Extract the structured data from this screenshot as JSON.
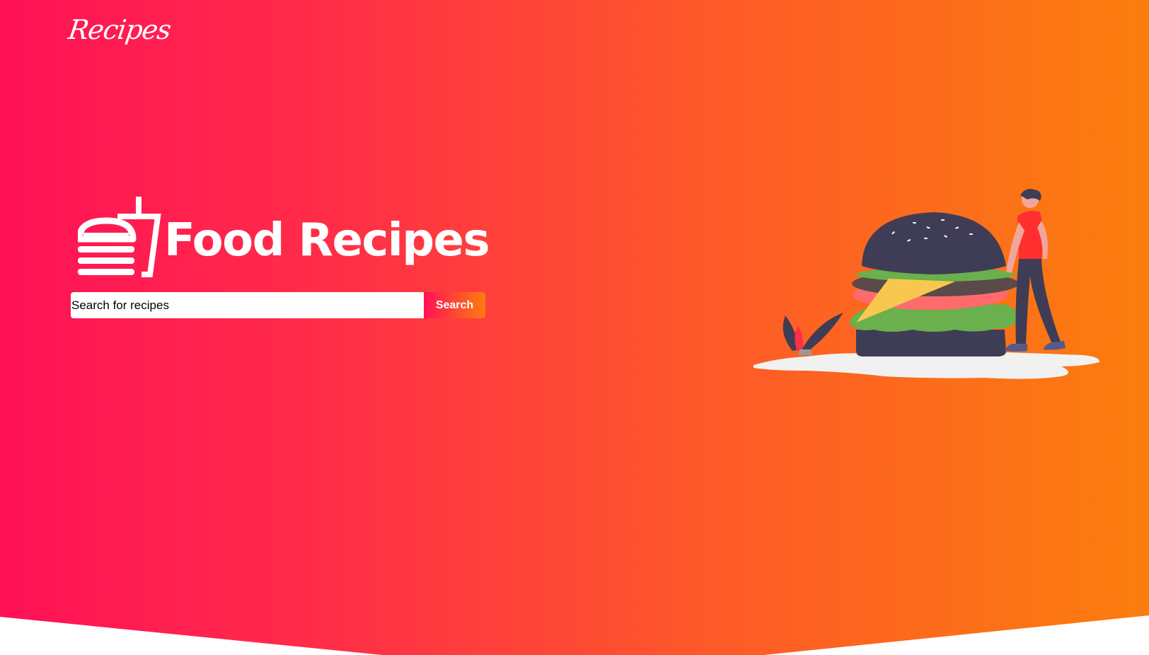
{
  "nav": {
    "logo_text": "Recipes"
  },
  "hero": {
    "title": "Food Recipes",
    "search": {
      "placeholder": "Search for recipes",
      "value": "",
      "button_label": "Search"
    }
  },
  "colors": {
    "gradient_start": "#ff1157",
    "gradient_end": "#fb7d0e",
    "text": "#ffffff"
  },
  "icons": {
    "brand": "burger-drink-icon",
    "illustration": "burger-with-person-illustration"
  }
}
